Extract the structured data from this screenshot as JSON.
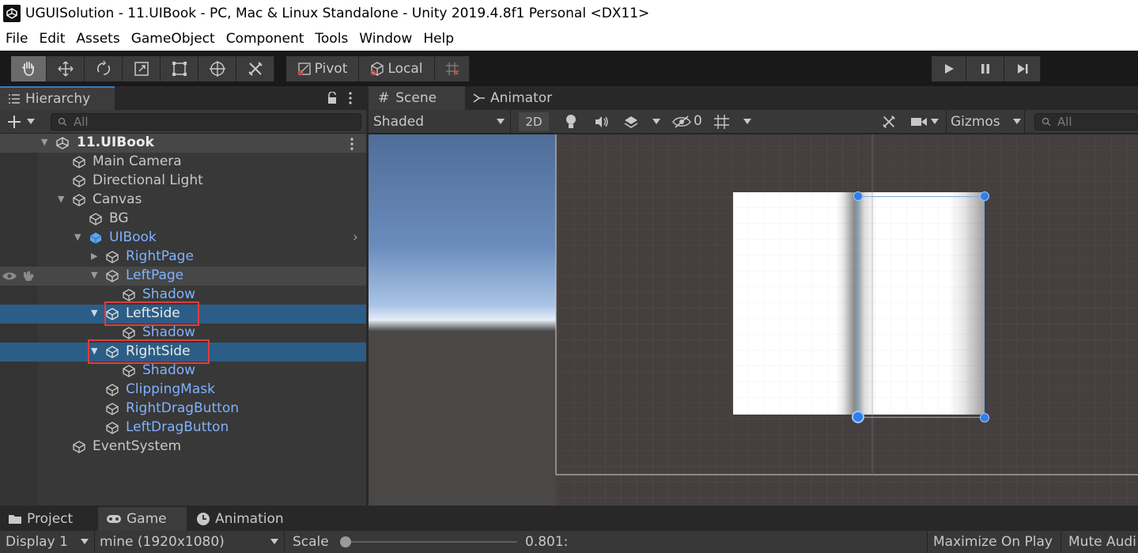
{
  "window": {
    "title": "UGUISolution - 11.UIBook - PC, Mac & Linux Standalone - Unity 2019.4.8f1 Personal <DX11>"
  },
  "menu": [
    "File",
    "Edit",
    "Assets",
    "GameObject",
    "Component",
    "Tools",
    "Window",
    "Help"
  ],
  "toolbar": {
    "pivot_label": "Pivot",
    "local_label": "Local"
  },
  "hierarchy": {
    "tab_label": "Hierarchy",
    "search_placeholder": "All",
    "scene_name": "11.UIBook",
    "items": [
      {
        "label": "Main Camera"
      },
      {
        "label": "Directional Light"
      },
      {
        "label": "Canvas"
      },
      {
        "label": "BG"
      },
      {
        "label": "UIBook"
      },
      {
        "label": "RightPage"
      },
      {
        "label": "LeftPage"
      },
      {
        "label": "Shadow"
      },
      {
        "label": "LeftSide"
      },
      {
        "label": "Shadow"
      },
      {
        "label": "RightSide"
      },
      {
        "label": "Shadow"
      },
      {
        "label": "ClippingMask"
      },
      {
        "label": "RightDragButton"
      },
      {
        "label": "LeftDragButton"
      },
      {
        "label": "EventSystem"
      }
    ]
  },
  "scene": {
    "tabs": [
      {
        "label": "Scene"
      },
      {
        "label": "Animator"
      }
    ],
    "shading_mode": "Shaded",
    "mode_2d": "2D",
    "hidden_count": "0",
    "gizmos_label": "Gizmos",
    "search_placeholder": "All"
  },
  "bottom": {
    "tabs": [
      {
        "label": "Project"
      },
      {
        "label": "Game"
      },
      {
        "label": "Animation"
      }
    ],
    "display": "Display 1",
    "resolution": "mine (1920x1080)",
    "scale_label": "Scale",
    "scale_value": "0.801:",
    "maximize_label": "Maximize On Play",
    "mute_label": "Mute Audi"
  },
  "colors": {
    "selection": "#2c5d87",
    "prefab_text": "#7fb2ff",
    "highlight_box": "#e23c3c",
    "gizmo_handle": "#2f7fe6"
  }
}
